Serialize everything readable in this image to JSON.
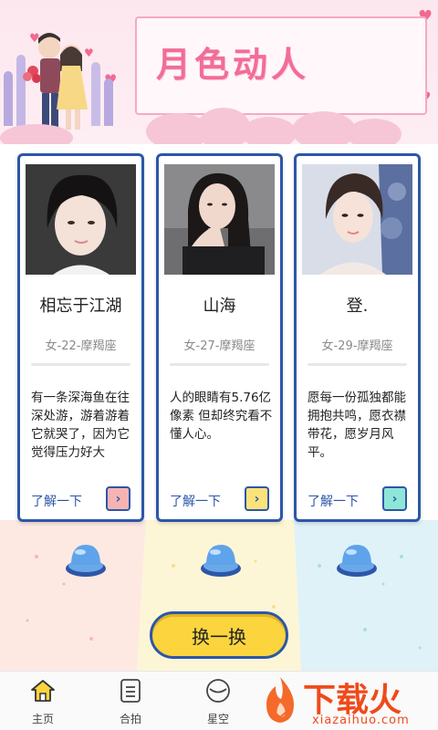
{
  "banner": {
    "title": "月色动人"
  },
  "cards": [
    {
      "name": "相忘于江湖",
      "meta": "女-22-摩羯座",
      "bio": "有一条深海鱼在往深处游，游着游着它就哭了，因为它觉得压力好大",
      "more_label": "了解一下",
      "arrow": "›",
      "accent": "#f6a9a9"
    },
    {
      "name": "山海",
      "meta": "女-27-摩羯座",
      "bio": "人的眼睛有5.76亿像素 但却终究看不懂人心。",
      "more_label": "了解一下",
      "arrow": "›",
      "accent": "#fbe27b"
    },
    {
      "name": "登.",
      "meta": "女-29-摩羯座",
      "bio": "愿每一份孤独都能拥抱共鸣，愿衣襟带花，愿岁月风平。",
      "more_label": "了解一下",
      "arrow": "›",
      "accent": "#8ee6d7"
    }
  ],
  "swap_button": {
    "label": "换一换"
  },
  "tabbar": {
    "items": [
      {
        "label": "主页",
        "icon": "home-icon"
      },
      {
        "label": "合拍",
        "icon": "document-icon"
      },
      {
        "label": "星空",
        "icon": "planet-icon"
      }
    ]
  },
  "watermark": {
    "brand": "下载火",
    "domain": "xiazaihuo.com"
  }
}
